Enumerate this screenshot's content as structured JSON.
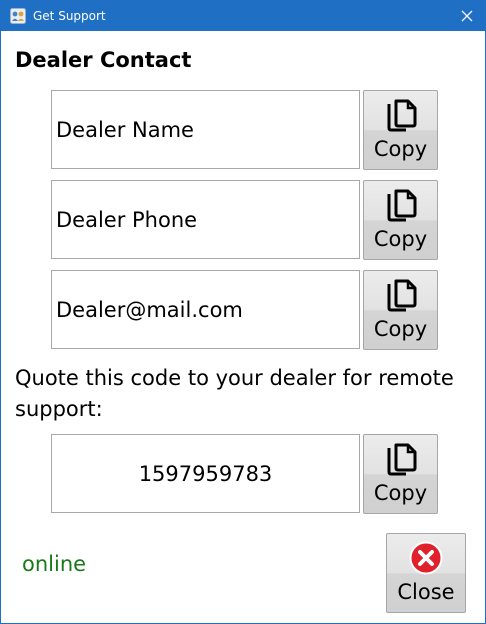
{
  "window": {
    "title": "Get Support",
    "titlebar_color": "#1f6fc4",
    "close_icon": "close-icon"
  },
  "dealer": {
    "heading": "Dealer Contact",
    "name": "Dealer Name",
    "phone": "Dealer Phone",
    "email": "Dealer@mail.com"
  },
  "support": {
    "prompt": "Quote this code to your dealer for remote support:",
    "code": "1597959783"
  },
  "buttons": {
    "copy_label": "Copy",
    "copy_icon": "copy-icon",
    "close_label": "Close",
    "close_icon": "close-circle-icon"
  },
  "status": {
    "text": "online",
    "color": "#1a7a1a"
  }
}
